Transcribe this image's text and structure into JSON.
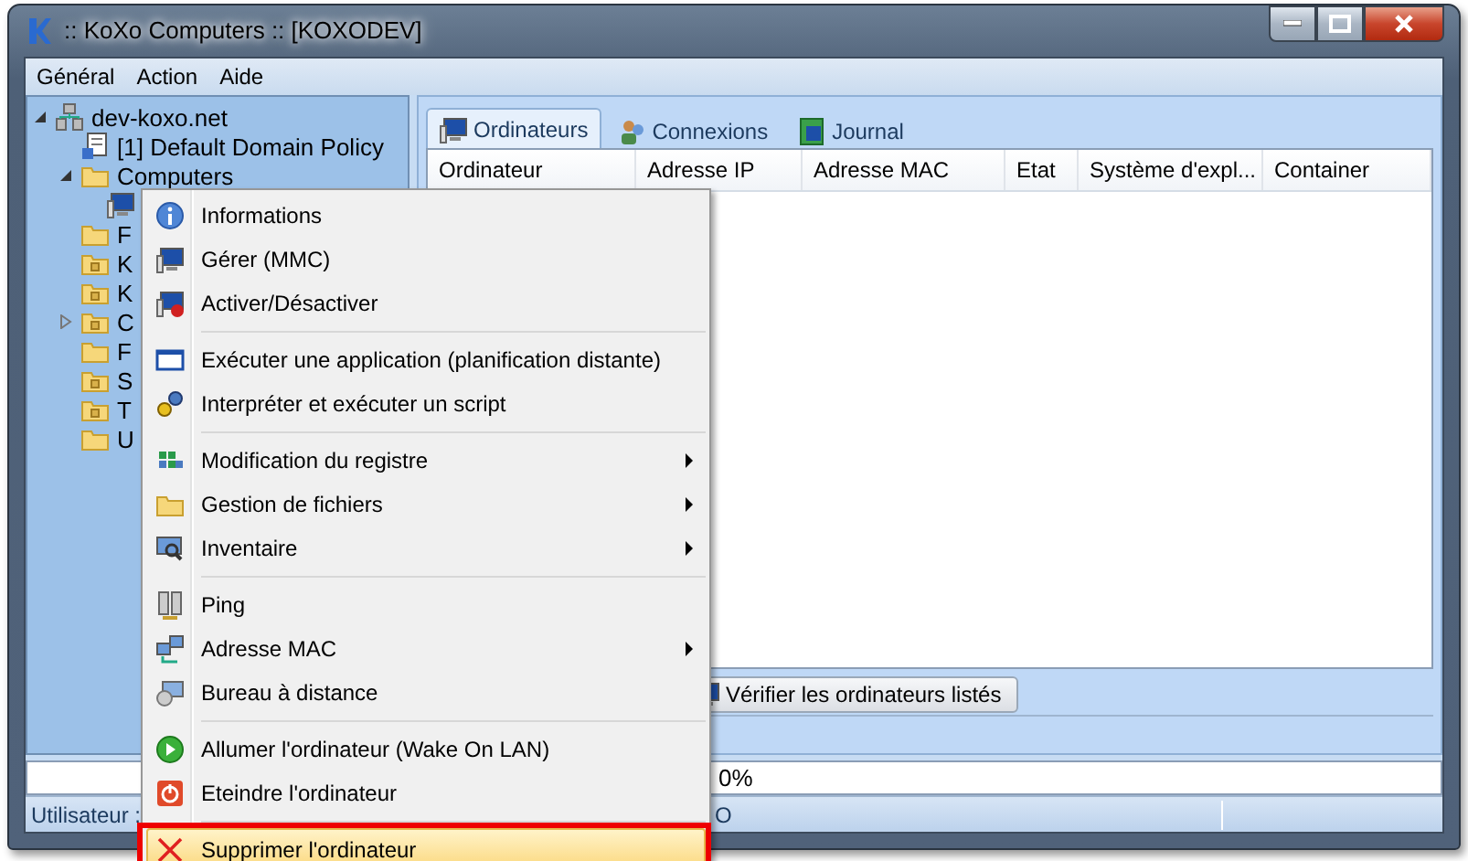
{
  "window": {
    "title": ":: KoXo Computers :: [KOXODEV]"
  },
  "menu": [
    "Général",
    "Action",
    "Aide"
  ],
  "tree": [
    {
      "label": "dev-koxo.net",
      "kind": "domain",
      "expanded": true,
      "children": [
        {
          "label": "[1] Default Domain Policy",
          "kind": "policy"
        },
        {
          "label": "Computers",
          "kind": "folder",
          "expanded": true,
          "children": [
            {
              "kind": "computer"
            }
          ]
        },
        {
          "label": "F",
          "kind": "folder"
        },
        {
          "label": "K",
          "kind": "ou"
        },
        {
          "label": "K",
          "kind": "ou"
        },
        {
          "label": "C",
          "kind": "ou",
          "expanded": false
        },
        {
          "label": "F",
          "kind": "folder"
        },
        {
          "label": "S",
          "kind": "ou"
        },
        {
          "label": "T",
          "kind": "ou"
        },
        {
          "label": "U",
          "kind": "folder"
        }
      ]
    }
  ],
  "tabs": [
    {
      "label": "Ordinateurs",
      "selected": true
    },
    {
      "label": "Connexions",
      "selected": false
    },
    {
      "label": "Journal",
      "selected": false
    }
  ],
  "table": {
    "columns": [
      "Ordinateur",
      "Adresse IP",
      "Adresse MAC",
      "Etat",
      "Système d'expl...",
      "Container"
    ]
  },
  "check_button": "Vérifier les ordinateurs listés",
  "progress": {
    "text": "0%"
  },
  "status_bar": [
    "Utilisateur :",
    "O"
  ],
  "context_menu": [
    {
      "kind": "item",
      "label": "Informations",
      "submenu": false,
      "selected": false
    },
    {
      "kind": "item",
      "label": "Gérer (MMC)",
      "submenu": false,
      "selected": false
    },
    {
      "kind": "item",
      "label": "Activer/Désactiver",
      "submenu": false,
      "selected": false
    },
    {
      "kind": "separator"
    },
    {
      "kind": "item",
      "label": "Exécuter une application (planification distante)",
      "submenu": false,
      "selected": false
    },
    {
      "kind": "item",
      "label": "Interpréter et exécuter un script",
      "submenu": false,
      "selected": false
    },
    {
      "kind": "separator"
    },
    {
      "kind": "item",
      "label": "Modification du registre",
      "submenu": true,
      "selected": false
    },
    {
      "kind": "item",
      "label": "Gestion de fichiers",
      "submenu": true,
      "selected": false
    },
    {
      "kind": "item",
      "label": "Inventaire",
      "submenu": true,
      "selected": false
    },
    {
      "kind": "separator"
    },
    {
      "kind": "item",
      "label": "Ping",
      "submenu": false,
      "selected": false
    },
    {
      "kind": "item",
      "label": "Adresse MAC",
      "submenu": true,
      "selected": false
    },
    {
      "kind": "item",
      "label": "Bureau à distance",
      "submenu": false,
      "selected": false
    },
    {
      "kind": "separator"
    },
    {
      "kind": "item",
      "label": "Allumer l'ordinateur (Wake On LAN)",
      "submenu": false,
      "selected": false
    },
    {
      "kind": "item",
      "label": "Eteindre l'ordinateur",
      "submenu": false,
      "selected": false
    },
    {
      "kind": "separator"
    },
    {
      "kind": "item",
      "label": "Supprimer l'ordinateur",
      "submenu": false,
      "selected": true,
      "annotated": true
    }
  ]
}
